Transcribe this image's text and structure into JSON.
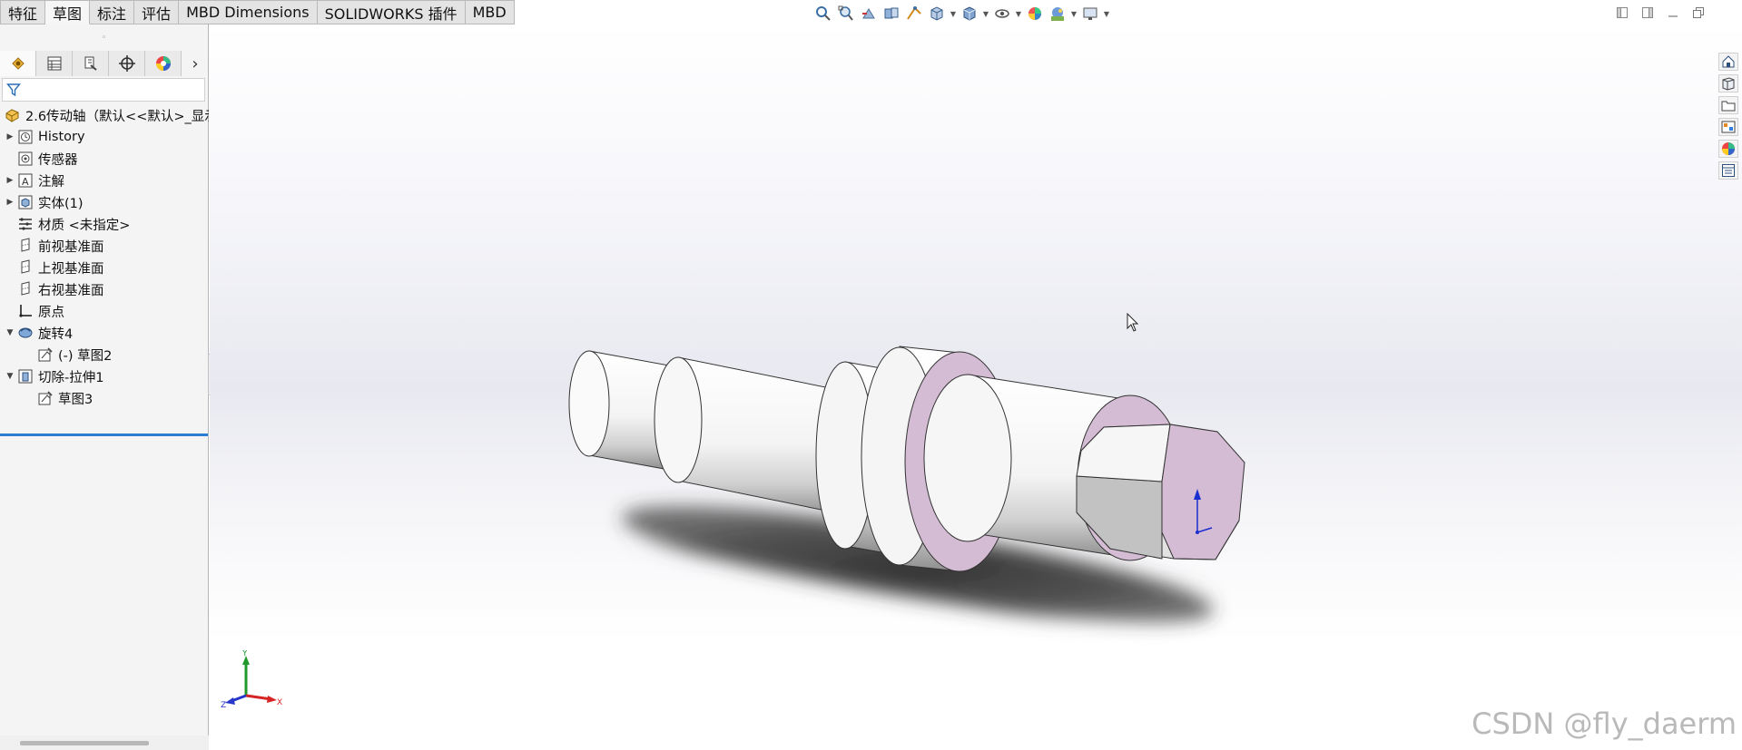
{
  "command_tabs": [
    {
      "label": "特征",
      "active": false
    },
    {
      "label": "草图",
      "active": true
    },
    {
      "label": "标注",
      "active": false
    },
    {
      "label": "评估",
      "active": false
    },
    {
      "label": "MBD Dimensions",
      "active": false
    },
    {
      "label": "SOLIDWORKS 插件",
      "active": false
    },
    {
      "label": "MBD",
      "active": false
    }
  ],
  "hud_icons": [
    "zoom-to-fit-icon",
    "zoom-area-icon",
    "previous-view-icon",
    "section-view-icon",
    "dynamic-annotation-icon",
    "view-orientation-icon",
    "display-style-icon",
    "hide-show-items-icon",
    "edit-appearance-icon",
    "apply-scene-icon",
    "view-settings-icon"
  ],
  "feature_tree": {
    "root": "2.6传动轴（默认<<默认>_显示",
    "items": [
      {
        "label": "History",
        "expandable": true,
        "icon": "history-icon",
        "depth": 0
      },
      {
        "label": "传感器",
        "expandable": false,
        "icon": "sensor-icon",
        "depth": 0
      },
      {
        "label": "注解",
        "expandable": true,
        "icon": "annotation-icon",
        "depth": 0
      },
      {
        "label": "实体(1)",
        "expandable": true,
        "icon": "solid-bodies-icon",
        "depth": 0
      },
      {
        "label": "材质 <未指定>",
        "expandable": false,
        "icon": "material-icon",
        "depth": 0
      },
      {
        "label": "前视基准面",
        "expandable": false,
        "icon": "plane-icon",
        "depth": 0
      },
      {
        "label": "上视基准面",
        "expandable": false,
        "icon": "plane-icon",
        "depth": 0
      },
      {
        "label": "右视基准面",
        "expandable": false,
        "icon": "plane-icon",
        "depth": 0
      },
      {
        "label": "原点",
        "expandable": false,
        "icon": "origin-icon",
        "depth": 0
      },
      {
        "label": "旋转4",
        "expandable": true,
        "expanded": true,
        "icon": "revolve-icon",
        "depth": 0
      },
      {
        "label": "(-) 草图2",
        "expandable": false,
        "icon": "sketch-icon",
        "depth": 1
      },
      {
        "label": "切除-拉伸1",
        "expandable": true,
        "expanded": true,
        "icon": "cut-extrude-icon",
        "depth": 0
      },
      {
        "label": "草图3",
        "expandable": false,
        "icon": "sketch-icon",
        "depth": 1
      }
    ]
  },
  "triad": {
    "x": "X",
    "y": "Y",
    "z": "Z"
  },
  "watermark": "CSDN @fly_daerm",
  "colors": {
    "face_pink": "#d4bcd4",
    "accent": "#2b7cd3"
  }
}
